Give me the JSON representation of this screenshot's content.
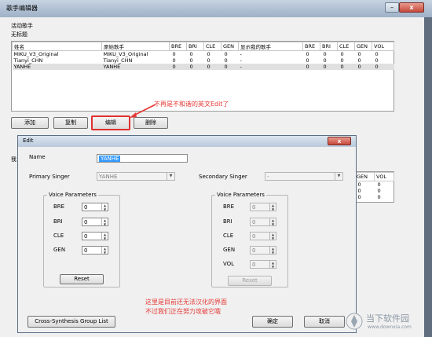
{
  "main_window": {
    "title": "歌手编辑器",
    "active_label": "活动歌手",
    "untitled_label": "无标题",
    "columns": [
      "姓名",
      "原始歌手",
      "BRE",
      "BRI",
      "CLE",
      "GEN",
      "显示我的歌手",
      "BRE",
      "BRI",
      "CLE",
      "GEN",
      "VOL"
    ],
    "rows": [
      [
        "MIKU_V3_Original",
        "MIKU_V3_Original",
        "0",
        "0",
        "0",
        "0",
        "-",
        "0",
        "0",
        "0",
        "0",
        "0"
      ],
      [
        "Tianyi_CHN",
        "Tianyi_CHN",
        "0",
        "0",
        "0",
        "0",
        "-",
        "0",
        "0",
        "0",
        "0",
        "0"
      ],
      [
        "YANHE",
        "YANHE",
        "0",
        "0",
        "0",
        "0",
        "-",
        "0",
        "0",
        "0",
        "0",
        "0"
      ]
    ],
    "buttons": {
      "add": "添加",
      "copy": "复制",
      "edit": "编辑",
      "delete": "删除"
    },
    "partial_label": "我",
    "bg_table_columns": [
      "GEN",
      "VOL"
    ],
    "bg_table_rows": [
      [
        "0",
        "0"
      ],
      [
        "0",
        "0"
      ],
      [
        "0",
        "0"
      ]
    ]
  },
  "annotations": {
    "top": "不再是不和谐的英文Edit了",
    "bottom_line1": "这里是目前还无法汉化的界面",
    "bottom_line2": "不过我们正在努力攻破它哦"
  },
  "edit_dialog": {
    "title": "Edit",
    "close_symbol": "x",
    "name_label": "Name",
    "name_value": "YANHE",
    "primary_label": "Primary Singer",
    "primary_value": "YANHE",
    "secondary_label": "Secondary Singer",
    "secondary_value": "-",
    "voice_params_label": "Voice Parameters",
    "left_params": [
      {
        "label": "BRE",
        "value": "0"
      },
      {
        "label": "BRI",
        "value": "0"
      },
      {
        "label": "CLE",
        "value": "0"
      },
      {
        "label": "GEN",
        "value": "0"
      }
    ],
    "right_params": [
      {
        "label": "BRE",
        "value": "0"
      },
      {
        "label": "BRI",
        "value": "0"
      },
      {
        "label": "CLE",
        "value": "0"
      },
      {
        "label": "GEN",
        "value": "0"
      },
      {
        "label": "VOL",
        "value": "0"
      }
    ],
    "reset_label": "Reset",
    "cross_synthesis_label": "Cross-Synthesis Group List",
    "ok_label": "确定",
    "cancel_label": "取消"
  },
  "watermark": {
    "text": "当下软件园",
    "subtext": "www.downxia.com"
  },
  "colors": {
    "annotation_red": "#e53935",
    "selection_blue": "#3399ff",
    "title_bar": "#b8c9dc"
  }
}
